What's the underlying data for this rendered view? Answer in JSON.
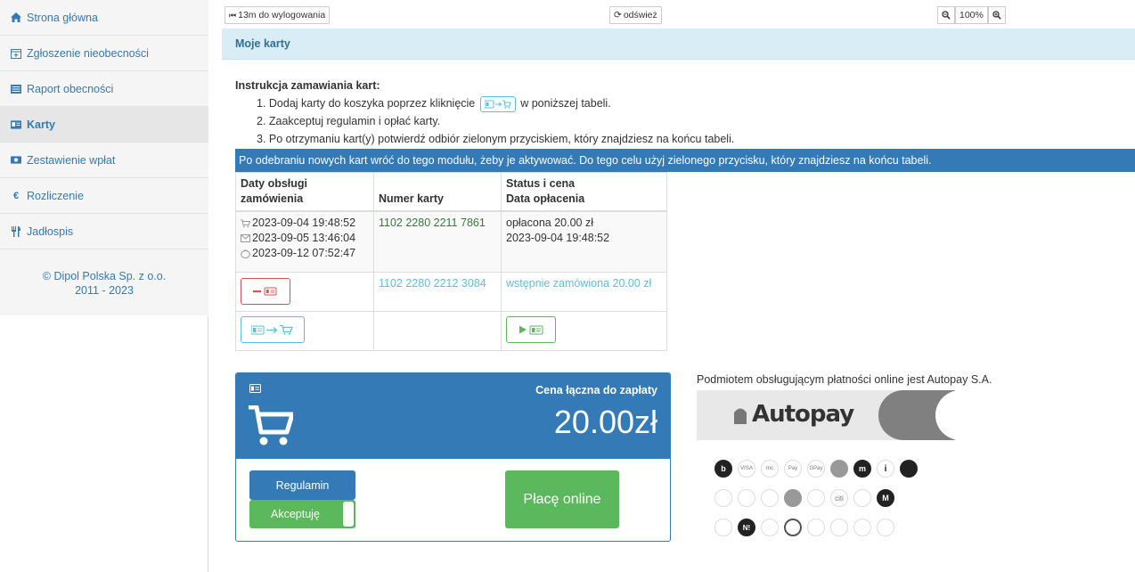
{
  "sidebar": {
    "items": [
      {
        "label": "Strona główna",
        "icon": "home-icon",
        "active": false
      },
      {
        "label": "Zgłoszenie nieobecności",
        "icon": "calendar-plus-icon",
        "active": false
      },
      {
        "label": "Raport obecności",
        "icon": "list-icon",
        "active": false
      },
      {
        "label": "Karty",
        "icon": "id-card-icon",
        "active": true
      },
      {
        "label": "Zestawienie wpłat",
        "icon": "money-icon",
        "active": false
      },
      {
        "label": "Rozliczenie",
        "icon": "euro-icon",
        "active": false
      },
      {
        "label": "Jadłospis",
        "icon": "cutlery-icon",
        "active": false
      }
    ],
    "footer_line1": "© Dipol Polska Sp. z o.o.",
    "footer_line2": "2011 - 2023"
  },
  "topbar": {
    "logout_label": "13m do wylogowania",
    "refresh_label": "odśwież",
    "zoom_value": "100%"
  },
  "panel": {
    "title": "Moje karty",
    "instructions_title": "Instrukcja zamawiania kart:",
    "step1_before": "1. Dodaj karty do koszyka poprzez kliknięcie",
    "step1_after": "w poniższej tabeli.",
    "step2": "2. Zaakceptuj regulamin i opłać karty.",
    "step3": "3. Po otrzymaniu kart(y) potwierdź odbiór zielonym przyciskiem, który znajdziesz na końcu tabeli.",
    "notice": "Po odebraniu nowych kart wróć do tego modułu, żeby je aktywować. Do tego celu użyj zielonego przycisku, który znajdziesz na końcu tabeli."
  },
  "table": {
    "headers": {
      "dates_line1": "Daty obsługi",
      "dates_line2": "zamówienia",
      "card_number": "Numer karty",
      "status_line1": "Status i cena",
      "status_line2": "Data opłacenia"
    },
    "row1": {
      "ordered": "2023-09-04 19:48:52",
      "sent": "2023-09-05 13:46:04",
      "received": "2023-09-12 07:52:47",
      "card_number": "1102 2280 2211 7861",
      "status": "opłacona 20.00 zł",
      "paid_date": "2023-09-04 19:48:52"
    },
    "row2": {
      "card_number": "1102 2280 2212 3084",
      "status": "wstępnie zamówiona 20.00 zł"
    }
  },
  "cart": {
    "total_label": "Cena łączna do zapłaty",
    "total_value": "20.00zł",
    "terms_button": "Regulamin",
    "accept_button": "Akceptuję",
    "pay_button": "Płacę online"
  },
  "autopay": {
    "info": "Podmiotem obsługującym płatności online jest Autopay S.A.",
    "logo_text": "Autopay"
  },
  "payment_methods": [
    [
      "b",
      "VISA",
      "mc",
      "Pay",
      "GPay",
      "",
      "m",
      "i",
      ""
    ],
    [
      "",
      "",
      "",
      "",
      "",
      "citi",
      "",
      "M"
    ],
    [
      "",
      "N!",
      "",
      "",
      "",
      "",
      "",
      ""
    ]
  ],
  "colors": {
    "primary": "#337ab7",
    "success": "#5cb85c",
    "info": "#5bc0de",
    "danger": "#d9534f",
    "panel_head": "#d9edf7"
  }
}
